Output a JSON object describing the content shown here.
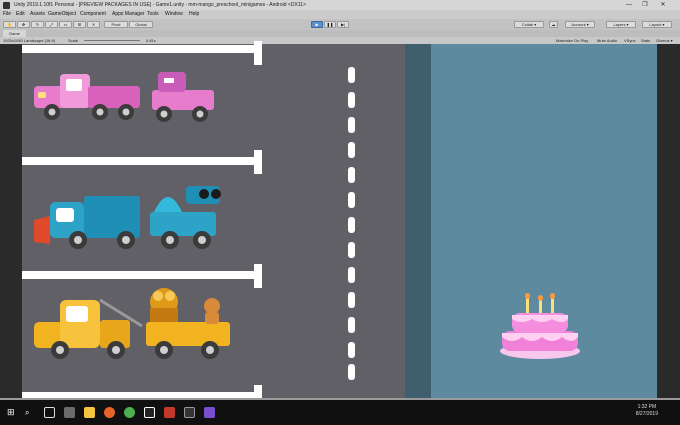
{
  "window": {
    "title": "Unity 2019.1.10f1 Personal - [PREVIEW PACKAGES IN USE] - Game1.unity - mm-mango_preschool_minigames - Android <DX11>",
    "controls": [
      "—",
      "❐",
      "✕"
    ]
  },
  "menu": [
    "File",
    "Edit",
    "Assets",
    "GameObject",
    "Component",
    "Apps Manager",
    "Tools",
    "Window",
    "Help"
  ],
  "toolbar": {
    "pivot_label": "Pivot",
    "global_label": "Global",
    "collab_label": "Collab ▾",
    "account_label": "Account ▾",
    "layers_label": "Layers ▾",
    "layout_label": "Layout ▾"
  },
  "game_tab": {
    "label": "Game"
  },
  "game_bar": {
    "resolution": "1920x1080 Landscape (16:9)",
    "scale_label": "Scale",
    "scale_value": "0.81x",
    "maximize": "Maximize On Play",
    "mute": "Mute Audio",
    "vsync": "VSync",
    "stats": "Stats",
    "gizmos": "Gizmos ▾"
  },
  "taskbar": {
    "time": "1:32 PM",
    "date": "8/27/2019"
  },
  "colors": {
    "road": "#616066",
    "sky": "#5e8aa0",
    "pink_truck": "#e77ccc",
    "blue_truck": "#2ea3c8",
    "yellow_truck": "#f2b320",
    "cake": "#f080d8"
  },
  "icons": [
    "windows-icon",
    "search-icon",
    "task-view-icon",
    "file-explorer-icon",
    "firefox-icon",
    "chrome-icon",
    "unity-icon",
    "app-icon",
    "visual-studio-icon"
  ]
}
